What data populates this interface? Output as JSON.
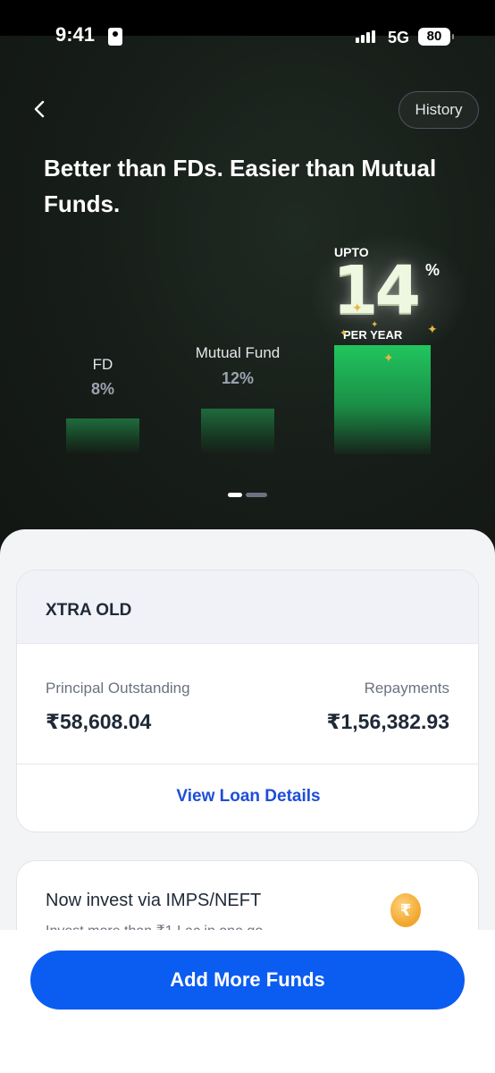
{
  "status_bar": {
    "time": "9:41",
    "network": "5G",
    "battery": "80"
  },
  "header": {
    "back_icon": "chevron-left-icon",
    "history_label": "History"
  },
  "hero": {
    "title": "Better than FDs. Easier than Mutual Funds.",
    "comparison": [
      {
        "label": "FD",
        "rate": "8%"
      },
      {
        "label": "Mutual Fund",
        "rate": "12%"
      }
    ],
    "highlight": {
      "prefix": "UPTO",
      "value": "14",
      "unit": "%",
      "suffix": "PER YEAR"
    },
    "carousel": {
      "pages": 2,
      "active": 1
    }
  },
  "loan": {
    "name": "XTRA OLD",
    "principal_label": "Principal Outstanding",
    "principal_value": "₹58,608.04",
    "repayments_label": "Repayments",
    "repayments_value": "₹1,56,382.93",
    "link_label": "View Loan Details"
  },
  "promo": {
    "title": "Now invest via IMPS/NEFT",
    "subtitle": "Invest more than ₹1 Lac in one go",
    "icon": "rupee-coin-icon"
  },
  "cta": {
    "label": "Add More Funds"
  },
  "colors": {
    "accent": "#0b5cf0",
    "success": "#22c55e",
    "hero_bg": "#161c18"
  }
}
